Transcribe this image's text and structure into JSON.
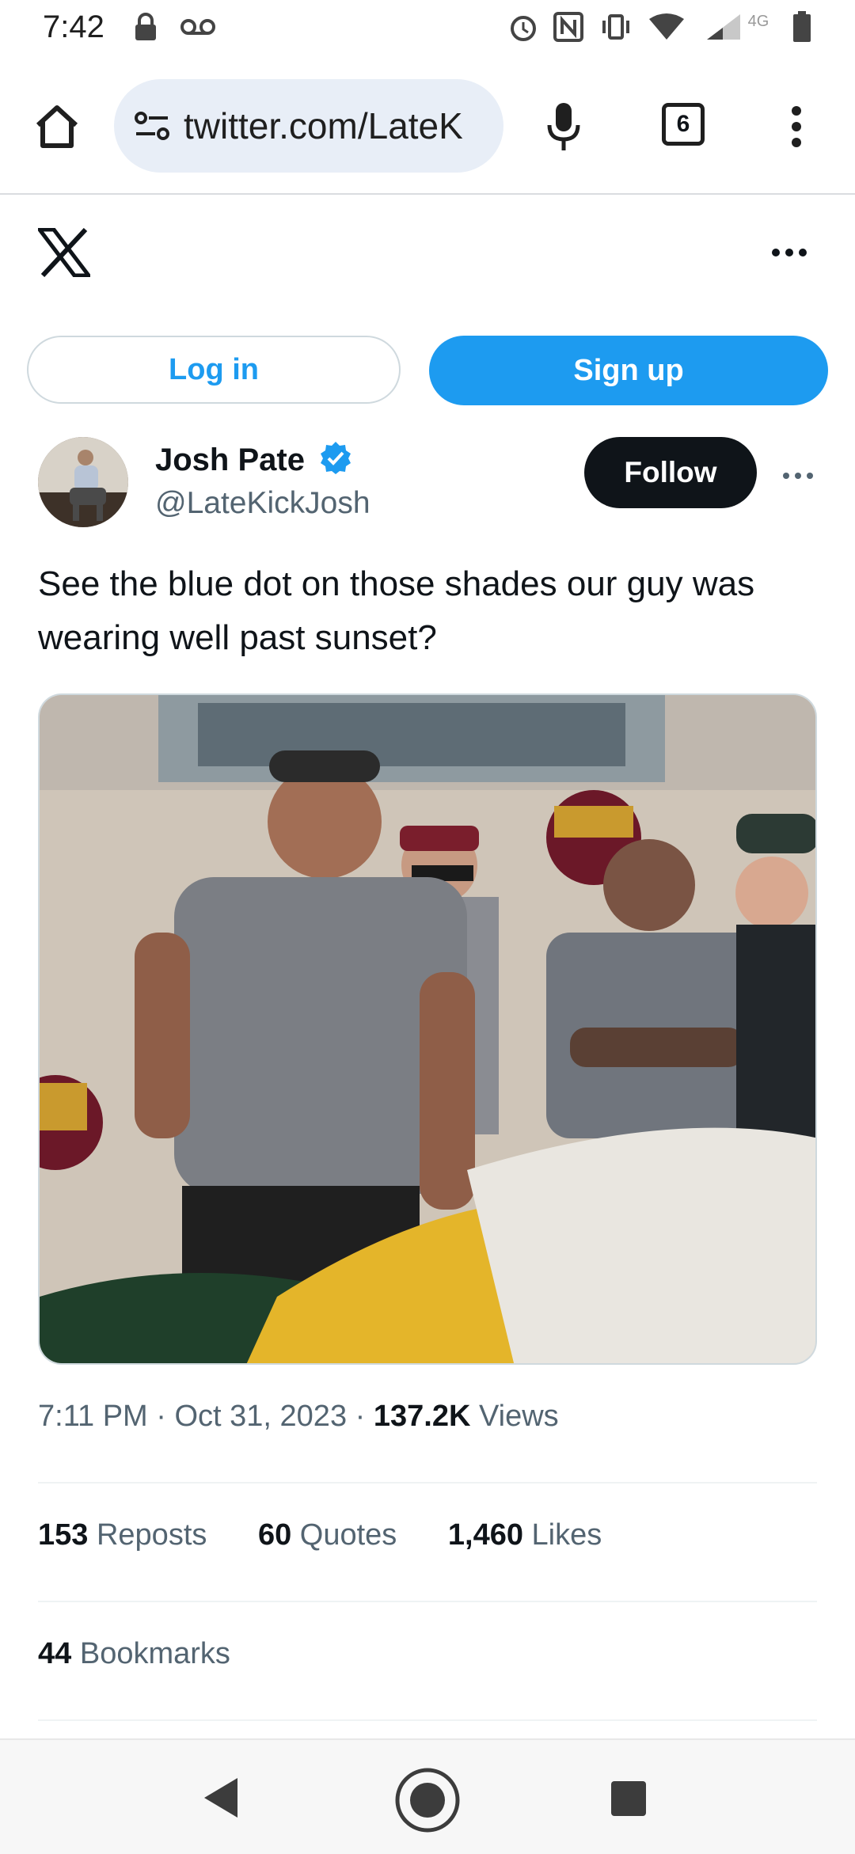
{
  "status_bar": {
    "time": "7:42",
    "icons": [
      "lock-icon",
      "voicemail-icon",
      "alarm-icon",
      "nfc-icon",
      "vibrate-icon",
      "wifi-icon",
      "signal-icon",
      "battery-icon"
    ],
    "network": "4G"
  },
  "browser": {
    "url": "twitter.com/LateK",
    "tab_count": "6"
  },
  "site": {
    "logo": "x-logo"
  },
  "auth": {
    "login_label": "Log in",
    "signup_label": "Sign up"
  },
  "tweet": {
    "author_name": "Josh Pate",
    "author_handle": "@LateKickJosh",
    "verified": true,
    "follow_label": "Follow",
    "text": "See the blue dot on those shades our guy was wearing well past sunset?",
    "time": "7:11 PM",
    "date": "Oct 31, 2023",
    "views_count": "137.2K",
    "views_label": "Views",
    "reposts_count": "153",
    "reposts_label": "Reposts",
    "quotes_count": "60",
    "quotes_label": "Quotes",
    "likes_count": "1,460",
    "likes_label": "Likes",
    "bookmarks_count": "44",
    "bookmarks_label": "Bookmarks"
  },
  "colors": {
    "accent": "#1d9bf0",
    "text": "#0f1419",
    "muted": "#536471"
  }
}
